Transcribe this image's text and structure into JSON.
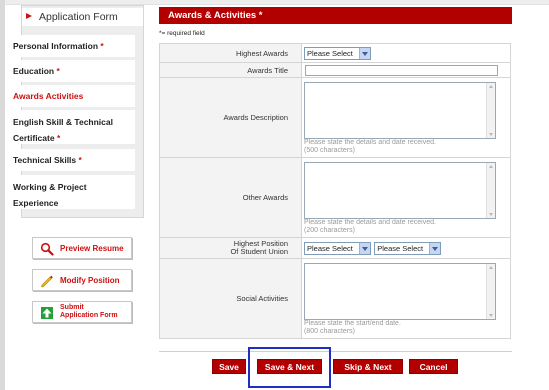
{
  "sidebar": {
    "title": "Application Form",
    "items": [
      {
        "label": "Personal Information",
        "required": "*"
      },
      {
        "label": "Education",
        "required": "*"
      },
      {
        "label": "Awards Activities",
        "required": ""
      },
      {
        "line1": "English Skill & Technical",
        "line2": "Certificate",
        "required": "*"
      },
      {
        "label": "Technical Skills",
        "required": "*"
      },
      {
        "line1": "Working & Project",
        "line2": "Experience",
        "required": ""
      }
    ]
  },
  "actions": {
    "preview": "Preview Resume",
    "modify": "Modify Position",
    "submit_line1": "Submit",
    "submit_line2": "Application Form"
  },
  "section": {
    "title": "Awards & Activities *",
    "required_note": "*= required field"
  },
  "form": {
    "highest_awards": {
      "label": "Highest Awards",
      "value": "Please Select"
    },
    "awards_title": {
      "label": "Awards Title",
      "value": ""
    },
    "awards_description": {
      "label": "Awards Description",
      "hint1": "Please state the details and date received.",
      "hint2": "(500 characters)"
    },
    "other_awards": {
      "label": "Other Awards",
      "hint1": "Please state the details and date received.",
      "hint2": "(200 characters)"
    },
    "highest_position": {
      "label1": "Highest Position",
      "label2": "Of Student Union",
      "value1": "Please Select",
      "value2": "Please Select"
    },
    "social_activities": {
      "label": "Social Activities",
      "hint1": "Please state the start/end date.",
      "hint2": "(800 characters)"
    }
  },
  "buttons": {
    "save": "Save",
    "save_next": "Save & Next",
    "skip_next": "Skip & Next",
    "cancel": "Cancel"
  },
  "colors": {
    "brand_red": "#b20000",
    "highlight_blue": "#1f2fc4"
  }
}
